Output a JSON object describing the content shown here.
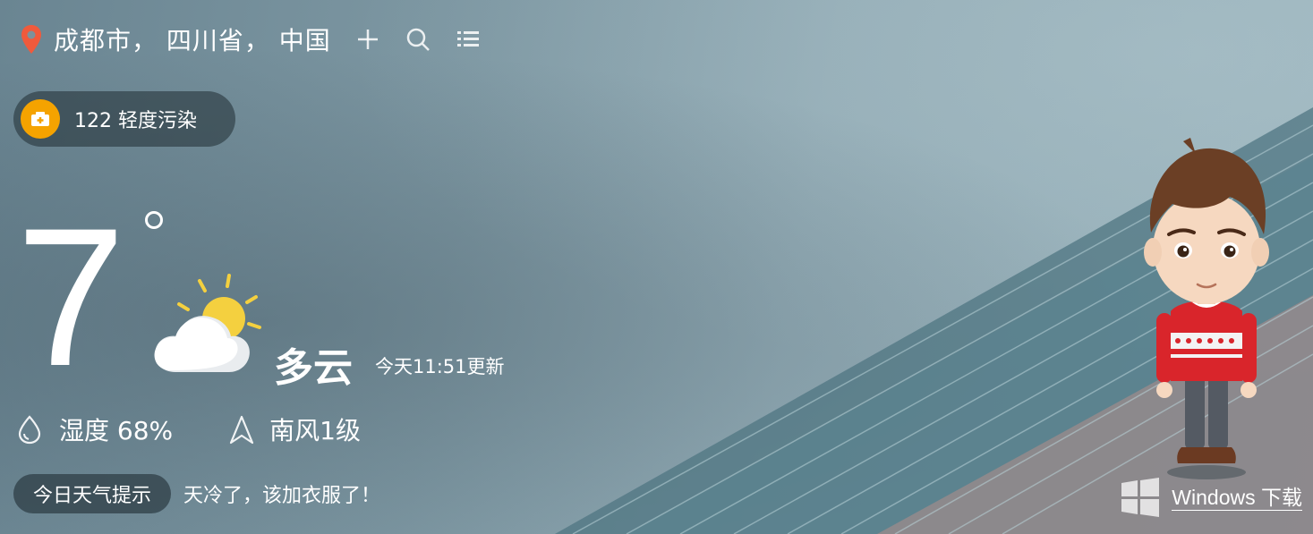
{
  "location": {
    "text": "成都市， 四川省， 中国"
  },
  "header_icons": [
    "location-pin-icon",
    "add-icon",
    "search-icon",
    "list-icon"
  ],
  "aqi": {
    "value": "122",
    "level": "轻度污染",
    "color": "#f5a300"
  },
  "weather": {
    "temperature": "7",
    "condition": "多云",
    "updated": "今天11:51更新",
    "icon": "partly-cloudy-icon"
  },
  "metrics": {
    "humidity_label": "湿度",
    "humidity_value": "68%",
    "wind": "南风1级"
  },
  "tip": {
    "label": "今日天气提示",
    "text": "天冷了，该加衣服了！"
  },
  "download": {
    "label": "Windows 下载"
  }
}
